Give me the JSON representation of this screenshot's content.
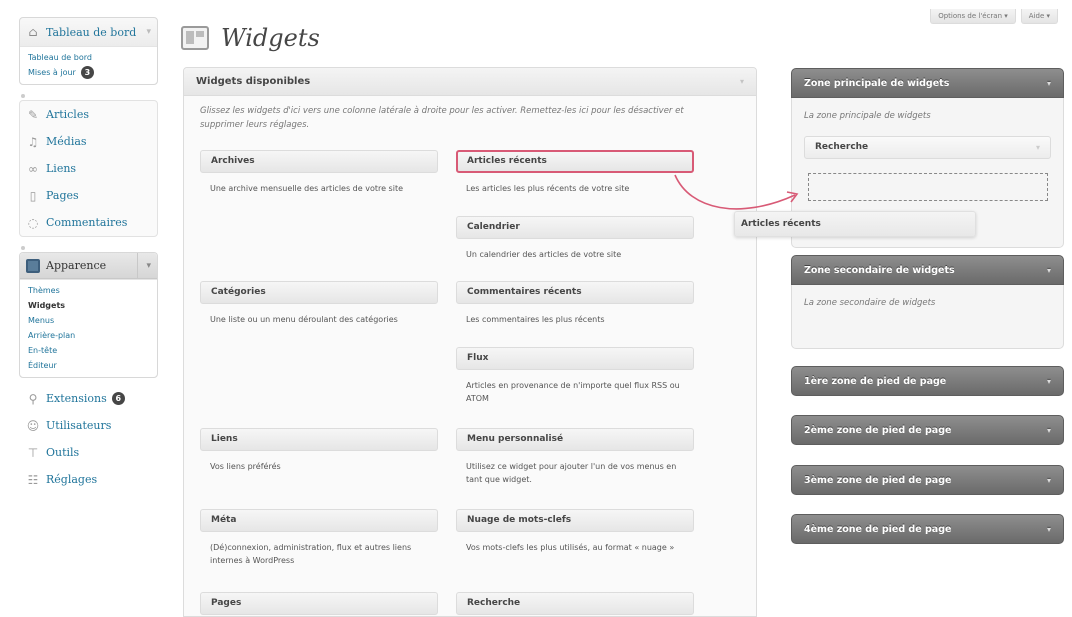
{
  "menu": {
    "dashboard": {
      "label": "Tableau de bord",
      "items": [
        {
          "label": "Tableau de bord"
        },
        {
          "label": "Mises à jour",
          "badge": "3"
        }
      ]
    },
    "items1": [
      {
        "label": "Articles",
        "icon": "pin-icon"
      },
      {
        "label": "Médias",
        "icon": "media-icon"
      },
      {
        "label": "Liens",
        "icon": "links-icon"
      },
      {
        "label": "Pages",
        "icon": "pages-icon"
      },
      {
        "label": "Commentaires",
        "icon": "comments-icon"
      }
    ],
    "appearance": {
      "label": "Apparence",
      "items": [
        {
          "label": "Thèmes"
        },
        {
          "label": "Widgets",
          "current": true
        },
        {
          "label": "Menus"
        },
        {
          "label": "Arrière-plan"
        },
        {
          "label": "En-tête"
        },
        {
          "label": "Éditeur"
        }
      ]
    },
    "items2": [
      {
        "label": "Extensions",
        "icon": "plugins-icon",
        "badge": "6"
      },
      {
        "label": "Utilisateurs",
        "icon": "users-icon"
      },
      {
        "label": "Outils",
        "icon": "tools-icon"
      },
      {
        "label": "Réglages",
        "icon": "settings-icon"
      }
    ]
  },
  "page": {
    "title": "Widgets"
  },
  "screen_options": {
    "options": "Options de l'écran ▾",
    "help": "Aide ▾"
  },
  "available": {
    "title": "Widgets disponibles",
    "description": "Glissez les widgets d'ici vers une colonne latérale à droite pour les activer. Remettez-les ici pour les désactiver et supprimer leurs réglages.",
    "widgets": [
      {
        "name": "Archives",
        "desc": "Une archive mensuelle des articles de votre site"
      },
      {
        "name": "Articles récents",
        "desc": "Les articles les plus récents de votre site"
      },
      {
        "name": "Calendrier",
        "desc": "Un calendrier des articles de votre site"
      },
      {
        "name": "Catégories",
        "desc": "Une liste ou un menu déroulant des catégories"
      },
      {
        "name": "Commentaires récents",
        "desc": "Les commentaires les plus récents"
      },
      {
        "name": "Flux",
        "desc": "Articles en provenance de n'importe quel flux RSS ou ATOM"
      },
      {
        "name": "Liens",
        "desc": "Vos liens préférés"
      },
      {
        "name": "Menu personnalisé",
        "desc": "Utilisez ce widget pour ajouter l'un de vos menus en tant que widget."
      },
      {
        "name": "Méta",
        "desc": "(Dé)connexion, administration, flux et autres liens internes à WordPress"
      },
      {
        "name": "Nuage de mots-clefs",
        "desc": "Vos mots-clefs les plus utilisés, au format « nuage »"
      },
      {
        "name": "Pages",
        "desc": ""
      },
      {
        "name": "Recherche",
        "desc": ""
      }
    ]
  },
  "sidebars": {
    "primary": {
      "title": "Zone principale de widgets",
      "desc": "La zone principale de widgets",
      "widget": "Recherche"
    },
    "secondary": {
      "title": "Zone secondaire de widgets",
      "desc": "La zone secondaire de widgets"
    },
    "footers": [
      {
        "title": "1ère zone de pied de page"
      },
      {
        "title": "2ème zone de pied de page"
      },
      {
        "title": "3ème zone de pied de page"
      },
      {
        "title": "4ème zone de pied de page"
      }
    ]
  },
  "dragging": {
    "label": "Articles récents"
  },
  "colors": {
    "highlight": "#d85a76",
    "link": "#21759b",
    "sidebar_header": "#7a7a7a"
  }
}
